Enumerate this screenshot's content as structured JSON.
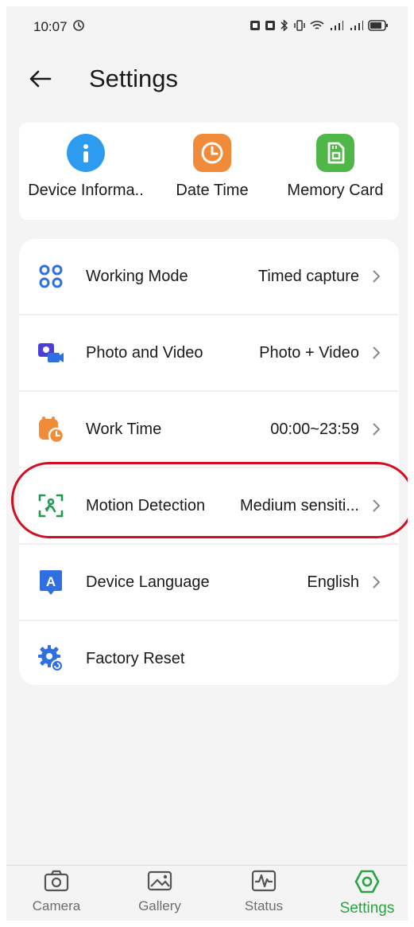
{
  "status_bar": {
    "time": "10:07"
  },
  "header": {
    "title": "Settings"
  },
  "quick": [
    {
      "label": "Device Informa..",
      "icon": "info-icon",
      "color": "#2d9cf0"
    },
    {
      "label": "Date Time",
      "icon": "clock-icon",
      "color": "#f08b3a"
    },
    {
      "label": "Memory Card",
      "icon": "sd-card-icon",
      "color": "#4fb748"
    }
  ],
  "settings": [
    {
      "label": "Working Mode",
      "value": "Timed capture",
      "icon": "grid-icon"
    },
    {
      "label": "Photo and Video",
      "value": "Photo + Video",
      "icon": "camera-video-icon"
    },
    {
      "label": "Work Time",
      "value": "00:00~23:59",
      "icon": "calendar-clock-icon"
    },
    {
      "label": "Motion Detection",
      "value": "Medium sensiti...",
      "icon": "motion-scan-icon"
    },
    {
      "label": "Device Language",
      "value": "English",
      "icon": "language-icon"
    },
    {
      "label": "Factory Reset",
      "value": "",
      "icon": "gear-reset-icon"
    }
  ],
  "nav": [
    {
      "label": "Camera",
      "icon": "camera-icon"
    },
    {
      "label": "Gallery",
      "icon": "gallery-icon"
    },
    {
      "label": "Status",
      "icon": "status-icon"
    },
    {
      "label": "Settings",
      "icon": "settings-hex-icon",
      "active": true
    }
  ],
  "colors": {
    "accent": "#2ca341",
    "highlight_ring": "#d01020",
    "icon_blue": "#2f6fe0"
  }
}
